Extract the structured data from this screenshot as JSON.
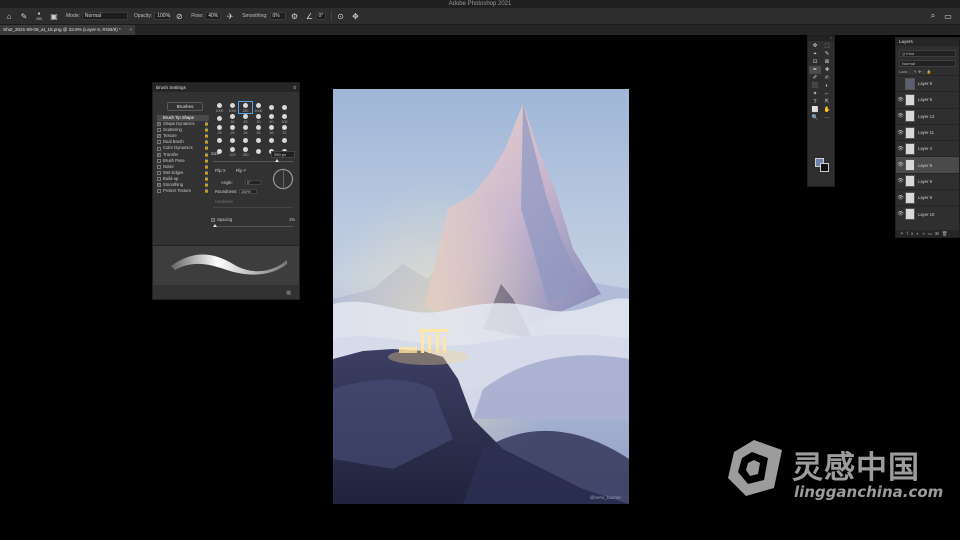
{
  "app": {
    "title": "Adobe Photoshop 2021"
  },
  "options_bar": {
    "brush_size": "250",
    "mode_label": "Mode:",
    "mode_value": "Normal",
    "opacity_label": "Opacity:",
    "opacity_value": "100%",
    "flow_label": "Flow:",
    "flow_value": "40%",
    "smoothing_label": "Smoothing:",
    "smoothing_value": "0%",
    "angle_value": "0°"
  },
  "document_tab": {
    "label": "Shot_2021-09-08_at_15.png @ 33.8% (Layer 6, RGB/8) *",
    "close": "×"
  },
  "brush_settings": {
    "title": "Brush Settings",
    "brushes_button": "Brushes",
    "items": [
      {
        "label": "Brush Tip Shape",
        "checked": false,
        "active": true
      },
      {
        "label": "Shape Dynamics",
        "checked": true
      },
      {
        "label": "Scattering",
        "checked": false
      },
      {
        "label": "Texture",
        "checked": true
      },
      {
        "label": "Dual Brush",
        "checked": false
      },
      {
        "label": "Color Dynamics",
        "checked": false
      },
      {
        "label": "Transfer",
        "checked": true
      },
      {
        "label": "Brush Pose",
        "checked": false
      },
      {
        "label": "Noise",
        "checked": false
      },
      {
        "label": "Wet Edges",
        "checked": false
      },
      {
        "label": "Build-up",
        "checked": false
      },
      {
        "label": "Smoothing",
        "checked": true
      },
      {
        "label": "Protect Texture",
        "checked": false
      }
    ],
    "tip_sizes": [
      "1000",
      "1000",
      "250",
      "1000",
      "",
      "",
      "",
      "30",
      "25",
      "30",
      "50",
      "100",
      "25",
      "25",
      "36",
      "36",
      "36",
      "32",
      "",
      "",
      "",
      "",
      "",
      "",
      "",
      "100",
      "250",
      "",
      "",
      ""
    ],
    "size_label": "Size",
    "size_value": "250 px",
    "flip_x": "Flip X",
    "flip_y": "Flip Y",
    "angle_label": "Angle:",
    "angle_value": "0°",
    "roundness_label": "Roundness:",
    "roundness_value": "100%",
    "hardness_label": "Hardness",
    "spacing_label": "Spacing",
    "spacing_value": "1%"
  },
  "canvas": {
    "credit": "@hervi_bucher"
  },
  "tools": {
    "items": [
      "✥",
      "⬚",
      "⌖",
      "✎",
      "⊡",
      "⊠",
      "✒",
      "✚",
      "✐",
      "✍",
      "⬛",
      "◐",
      "✦",
      "⌐",
      "T",
      "⇱",
      "⬜",
      "✋",
      "🔍",
      "⋯"
    ]
  },
  "layers": {
    "title": "Layers",
    "search_placeholder": "Q Kind",
    "blend_mode": "Normal",
    "lock_label": "Lock:",
    "rows": [
      {
        "name": "Layer 6",
        "visible": false,
        "dark": true
      },
      {
        "name": "Layer 5",
        "visible": true
      },
      {
        "name": "Layer 12",
        "visible": true
      },
      {
        "name": "Layer 11",
        "visible": true
      },
      {
        "name": "Layer 4",
        "visible": true
      },
      {
        "name": "Layer 8",
        "visible": true,
        "selected": true
      },
      {
        "name": "Layer 9",
        "visible": true
      },
      {
        "name": "Layer 8",
        "visible": true
      },
      {
        "name": "Layer 10",
        "visible": true
      }
    ]
  },
  "watermark": {
    "cn": "灵感中国",
    "en": "lingganchina.com"
  }
}
